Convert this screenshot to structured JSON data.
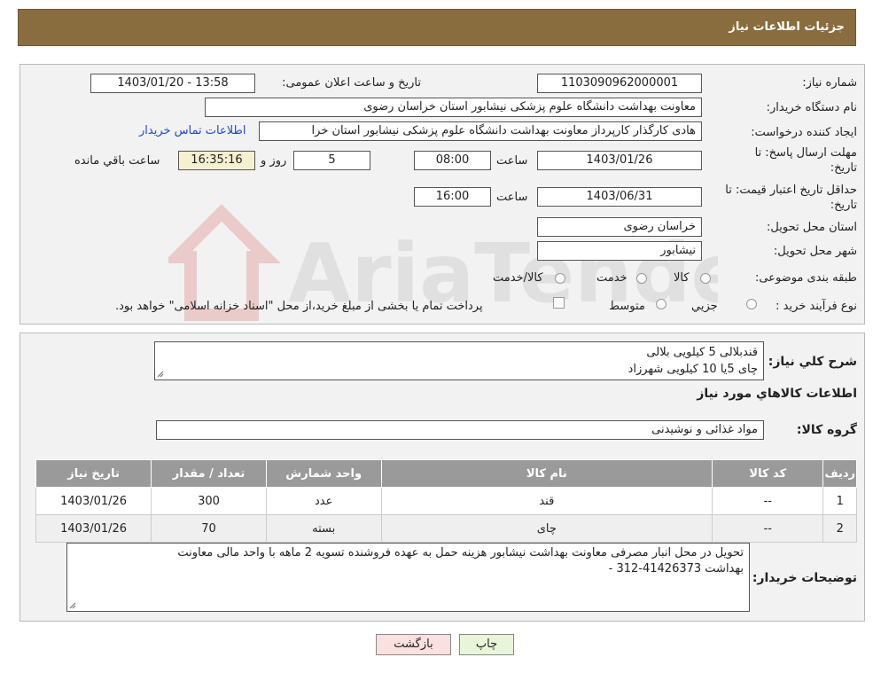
{
  "header": {
    "title": "جزئیات اطلاعات نیاز"
  },
  "info": {
    "need_number_label": "شماره نیاز:",
    "need_number": "1103090962000001",
    "announce_label": "تاریخ و ساعت اعلان عمومی:",
    "announce_value": "1403/01/20 - 13:58",
    "buyer_org_label": "نام دستگاه خریدار:",
    "buyer_org": "معاونت بهداشت دانشگاه علوم پزشکی نیشابور استان خراسان رضوی",
    "creator_label": "ایجاد کننده درخواست:",
    "creator": "هادی کارگذار کارپرداز معاونت بهداشت دانشگاه علوم پزشکی نیشابور استان خرا",
    "contact_link": "اطلاعات تماس خریدار",
    "deadline_label_1": "مهلت ارسال پاسخ: تا",
    "deadline_label_2": "تاریخ:",
    "deadline_date": "1403/01/26",
    "time_label": "ساعت",
    "deadline_time": "08:00",
    "days_value": "5",
    "days_label": "روز و",
    "remaining_time": "16:35:16",
    "remaining_label": "ساعت باقي مانده",
    "min_validity_label_1": "حداقل تاریخ اعتبار قیمت: تا",
    "min_validity_label_2": "تاریخ:",
    "validity_date": "1403/06/31",
    "validity_time": "16:00",
    "province_label": "استان محل تحویل:",
    "province": "خراسان رضوی",
    "city_label": "شهر محل تحویل:",
    "city": "نیشابور",
    "category_label": "طبقه بندی موضوعی:",
    "category_options": [
      "کالا",
      "خدمت",
      "کالا/خدمت"
    ],
    "purchase_type_label": "نوع فرآیند خرید :",
    "purchase_options": [
      "جزیي",
      "متوسط"
    ],
    "purchase_note": "پرداخت تمام یا بخشی از مبلغ خرید،از محل \"اسناد خزانه اسلامی\" خواهد بود."
  },
  "details": {
    "summary_label": "شرح کلي نیاز:",
    "summary_lines": [
      "قندبلالی 5 کیلویی بلالی",
      "چای 5یا 10 کیلویی شهرزاد"
    ],
    "items_title": "اطلاعات کالاهاي مورد نیاز",
    "group_label": "گروه کالا:",
    "group_value": "مواد غذائی و نوشیدنی",
    "columns": [
      "ردیف",
      "کد کالا",
      "نام کالا",
      "واحد شمارش",
      "تعداد / مقدار",
      "تاریخ نیاز"
    ],
    "rows": [
      [
        "1",
        "--",
        "قند",
        "عدد",
        "300",
        "1403/01/26"
      ],
      [
        "2",
        "--",
        "چای",
        "بسته",
        "70",
        "1403/01/26"
      ]
    ],
    "buyer_notes_label": "توضیحات خریدار:",
    "buyer_notes_lines": [
      "تحویل در محل انبار مصرفی معاونت بهداشت نیشابور هزینه حمل به عهده فروشنده تسویه 2 ماهه با واحد مالی معاونت",
      "بهداشت 41426373-312 -"
    ]
  },
  "buttons": {
    "print": "چاپ",
    "back": "بازگشت"
  },
  "watermark": {
    "text": "AriaTender.neT"
  },
  "colors": {
    "header": "#8a6d3f",
    "table_header": "#9a9a9a",
    "print_button": "#e8f5d8",
    "back_button": "#fbe0e0",
    "link": "#1a4ad6"
  }
}
